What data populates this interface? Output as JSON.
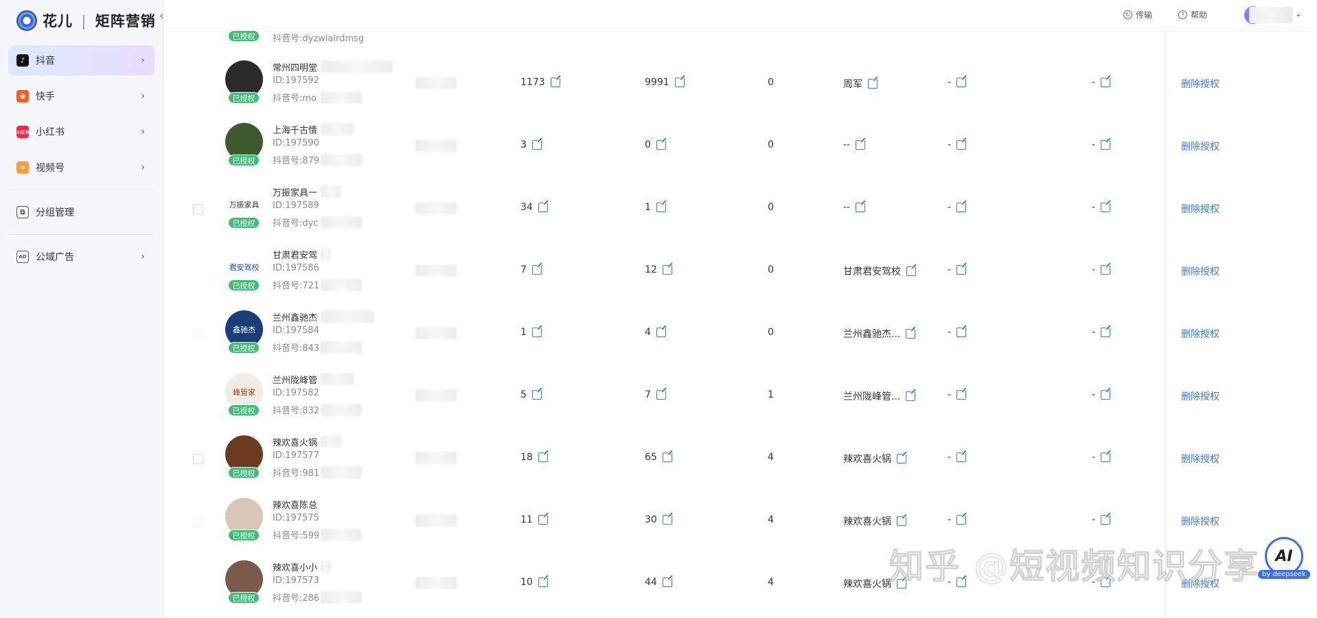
{
  "brand": {
    "name": "花儿",
    "separator": "|",
    "product": "矩阵营销"
  },
  "sidebar": {
    "items": [
      {
        "label": "抖音",
        "icon": "douyin-icon",
        "color": "#111111",
        "active": true
      },
      {
        "label": "快手",
        "icon": "kuaishou-icon",
        "color": "#ff5a1f"
      },
      {
        "label": "小红书",
        "icon": "xiaohongshu-icon",
        "color": "#ff2442",
        "icon_text": "小红书"
      },
      {
        "label": "视频号",
        "icon": "shipinhao-icon",
        "color": "#fa9d3b"
      },
      {
        "label": "分组管理",
        "icon": "group-icon"
      },
      {
        "label": "公域广告",
        "icon": "ad-icon",
        "icon_text": "AD"
      }
    ]
  },
  "topbar": {
    "transfer": "传输",
    "help": "帮助"
  },
  "prev_row": {
    "badge": "已授权",
    "douyin": "抖音号:dyzwialrdmsg"
  },
  "rows": [
    {
      "name": "常州四明堂",
      "id": "ID:197592",
      "douyin": "抖音号:mo",
      "badge": "已授权",
      "c1": "1173",
      "c2": "9991",
      "c3": "0",
      "c4": "周军",
      "c5": "-",
      "c6": "-",
      "action": "删除授权"
    },
    {
      "name": "上海千古情",
      "id": "ID:197590",
      "douyin": "抖音号:879",
      "badge": "已授权",
      "c1": "3",
      "c2": "0",
      "c3": "0",
      "c4": "--",
      "c5": "-",
      "c6": "-",
      "action": "删除授权"
    },
    {
      "name": "万振家具一",
      "id": "ID:197589",
      "douyin": "抖音号:dyc",
      "badge": "已授权",
      "avatar_text": "万振家具",
      "c1": "34",
      "c2": "1",
      "c3": "0",
      "c4": "--",
      "c5": "-",
      "c6": "-",
      "action": "删除授权"
    },
    {
      "name": "甘肃君安驾",
      "id": "ID:197586",
      "douyin": "抖音号:721",
      "badge": "已授权",
      "avatar_text": "君安驾校",
      "c1": "7",
      "c2": "12",
      "c3": "0",
      "c4": "甘肃君安驾校",
      "c5": "-",
      "c6": "-",
      "action": "删除授权"
    },
    {
      "name": "兰州鑫驰杰",
      "id": "ID:197584",
      "douyin": "抖音号:843",
      "badge": "已授权",
      "avatar_text": "鑫驰杰",
      "c1": "1",
      "c2": "4",
      "c3": "0",
      "c4": "兰州鑫驰杰...",
      "c5": "-",
      "c6": "-",
      "action": "删除授权"
    },
    {
      "name": "兰州陇峰管",
      "id": "ID:197582",
      "douyin": "抖音号:832",
      "badge": "已授权",
      "avatar_text": "峰管家",
      "c1": "5",
      "c2": "7",
      "c3": "1",
      "c4": "兰州陇峰管...",
      "c5": "-",
      "c6": "-",
      "action": "删除授权"
    },
    {
      "name": "辣欢喜火锅",
      "id": "ID:197577",
      "douyin": "抖音号:981",
      "badge": "已授权",
      "c1": "18",
      "c2": "65",
      "c3": "4",
      "c4": "辣欢喜火锅",
      "c5": "-",
      "c6": "-",
      "action": "删除授权"
    },
    {
      "name": "辣欢喜陈总",
      "id": "ID:197575",
      "douyin": "抖音号:599",
      "badge": "已授权",
      "c1": "11",
      "c2": "30",
      "c3": "4",
      "c4": "辣欢喜火锅",
      "c5": "-",
      "c6": "-",
      "action": "删除授权"
    },
    {
      "name": "辣欢喜小小",
      "id": "ID:197573",
      "douyin": "抖音号:286",
      "badge": "已授权",
      "c1": "10",
      "c2": "44",
      "c3": "4",
      "c4": "辣欢喜火锅",
      "c5": "-",
      "c6": "-",
      "action": "删除授权"
    }
  ],
  "watermark": "知乎 @短视频知识分享",
  "ai_button": {
    "label": "AI",
    "tag": "by deepseek"
  },
  "colors": {
    "accent": "#3a7bd5",
    "badge": "#3fbf76",
    "active_nav_from": "#dbe9ff",
    "active_nav_to": "#eadcff"
  }
}
